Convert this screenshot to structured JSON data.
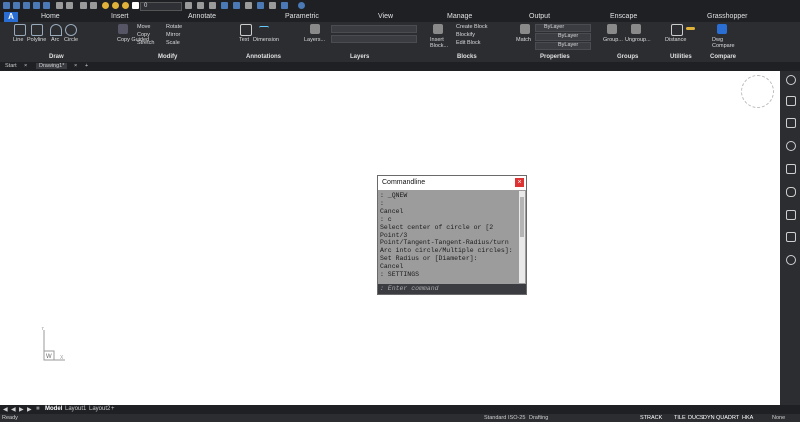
{
  "quick_access": {
    "layer_value": "0"
  },
  "app": {
    "logo_icon": "autocad-a-icon",
    "brand_color": "#2a6ed4"
  },
  "menu_tabs": [
    "Home",
    "Insert",
    "Annotate",
    "Parametric",
    "View",
    "Manage",
    "Output",
    "Enscape",
    "Grasshopper"
  ],
  "ribbon": {
    "draw": {
      "title": "Draw",
      "tools": [
        "Line",
        "Polyline",
        "Arc",
        "Circle"
      ]
    },
    "modify": {
      "title": "Modify",
      "tools": [
        "Move",
        "Rotate",
        "Copy",
        "Mirror",
        "Stretch",
        "Scale",
        "Copy Guided"
      ]
    },
    "annotations": {
      "title": "Annotations",
      "tools": [
        "Text",
        "Dimension"
      ]
    },
    "layers": {
      "title": "Layers",
      "tools": [
        "Layers..."
      ]
    },
    "blocks": {
      "title": "Blocks",
      "tools": [
        "Insert Block...",
        "Create Block",
        "Blockify",
        "Edit Block"
      ]
    },
    "properties": {
      "title": "Properties",
      "tools": [
        "Match",
        "ByLayer",
        "ByLayer",
        "ByLayer"
      ]
    },
    "groups": {
      "title": "Groups",
      "tools": [
        "Group...",
        "Ungroup..."
      ]
    },
    "utilities": {
      "title": "Utilities",
      "tools": [
        "Distance"
      ]
    },
    "compare": {
      "title": "Compare",
      "tools": [
        "Dwg Compare"
      ]
    }
  },
  "doc_tabs": {
    "start": "Start",
    "active": "Drawing1*"
  },
  "command_window": {
    "title": "Commandline",
    "close_icon": "×",
    "log": [
      ": _QNEW",
      ":",
      "Cancel",
      ": c",
      "Select center of circle or [2",
      "Point/3",
      "Point/Tangent-Tangent-Radius/turn",
      "Arc into circle/Multiple circles]:",
      "Set Radius or [Diameter]:",
      "Cancel",
      ": SETTINGS"
    ],
    "input_placeholder": ": Enter command"
  },
  "ucs": {
    "y_label": "Y",
    "w_label": "W",
    "x_label": "X"
  },
  "layout_tabs": [
    "Model",
    "Layout1",
    "Layout2"
  ],
  "status_bar": {
    "left": "Ready",
    "items": [
      "Standard",
      "ISO-25",
      "Drafting",
      "STRACK",
      "TILE",
      "DUCS",
      "DYN",
      "QUAD",
      "RT",
      "HKA",
      "None"
    ]
  }
}
